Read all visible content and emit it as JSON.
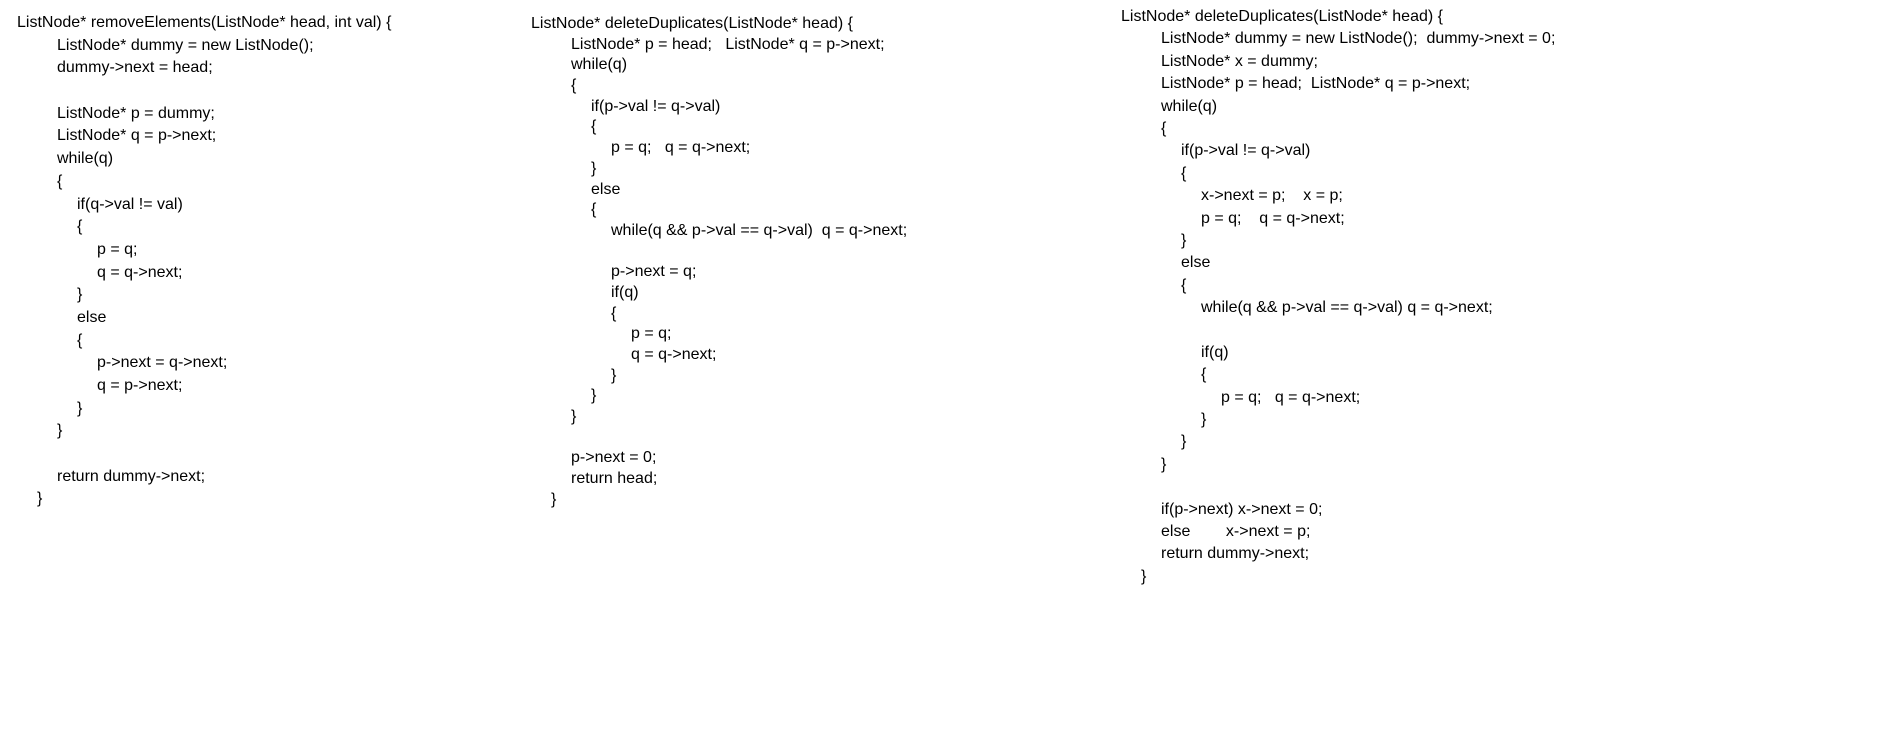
{
  "columns": [
    {
      "name": "remove-elements-code",
      "lines": [
        {
          "indent": 0,
          "text": "ListNode* removeElements(ListNode* head, int val) {"
        },
        {
          "indent": 1,
          "text": "ListNode* dummy = new ListNode();"
        },
        {
          "indent": 1,
          "text": "dummy->next = head;"
        },
        {
          "indent": 1,
          "text": ""
        },
        {
          "indent": 1,
          "text": "ListNode* p = dummy;"
        },
        {
          "indent": 1,
          "text": "ListNode* q = p->next;"
        },
        {
          "indent": 1,
          "text": "while(q)"
        },
        {
          "indent": 1,
          "text": "{"
        },
        {
          "indent": 2,
          "text": "if(q->val != val)"
        },
        {
          "indent": 2,
          "text": "{"
        },
        {
          "indent": 3,
          "text": "p = q;"
        },
        {
          "indent": 3,
          "text": "q = q->next;"
        },
        {
          "indent": 2,
          "text": "}"
        },
        {
          "indent": 2,
          "text": "else"
        },
        {
          "indent": 2,
          "text": "{"
        },
        {
          "indent": 3,
          "text": "p->next = q->next;"
        },
        {
          "indent": 3,
          "text": "q = p->next;"
        },
        {
          "indent": 2,
          "text": "}"
        },
        {
          "indent": 1,
          "text": "}"
        },
        {
          "indent": 1,
          "text": ""
        },
        {
          "indent": 1,
          "text": "return dummy->next;"
        },
        {
          "indent": 0.5,
          "text": "}"
        }
      ]
    },
    {
      "name": "delete-duplicates-code-1",
      "lines": [
        {
          "indent": 0,
          "text": "ListNode* deleteDuplicates(ListNode* head) {"
        },
        {
          "indent": 1,
          "text": "ListNode* p = head;   ListNode* q = p->next;"
        },
        {
          "indent": 1,
          "text": "while(q)"
        },
        {
          "indent": 1,
          "text": "{"
        },
        {
          "indent": 2,
          "text": "if(p->val != q->val)"
        },
        {
          "indent": 2,
          "text": "{"
        },
        {
          "indent": 3,
          "text": "p = q;   q = q->next;"
        },
        {
          "indent": 2,
          "text": "}"
        },
        {
          "indent": 2,
          "text": "else"
        },
        {
          "indent": 2,
          "text": "{"
        },
        {
          "indent": 3,
          "text": "while(q && p->val == q->val)  q = q->next;"
        },
        {
          "indent": 3,
          "text": ""
        },
        {
          "indent": 3,
          "text": "p->next = q;"
        },
        {
          "indent": 3,
          "text": "if(q)"
        },
        {
          "indent": 3,
          "text": "{"
        },
        {
          "indent": 4,
          "text": "p = q;"
        },
        {
          "indent": 4,
          "text": "q = q->next;"
        },
        {
          "indent": 3,
          "text": "}"
        },
        {
          "indent": 2,
          "text": "}"
        },
        {
          "indent": 1,
          "text": "}"
        },
        {
          "indent": 1,
          "text": ""
        },
        {
          "indent": 1,
          "text": "p->next = 0;"
        },
        {
          "indent": 1,
          "text": "return head;"
        },
        {
          "indent": 0.5,
          "text": "}"
        }
      ]
    },
    {
      "name": "delete-duplicates-code-2",
      "lines": [
        {
          "indent": 0,
          "text": "ListNode* deleteDuplicates(ListNode* head) {"
        },
        {
          "indent": 1,
          "text": "ListNode* dummy = new ListNode();  dummy->next = 0;"
        },
        {
          "indent": 1,
          "text": "ListNode* x = dummy;"
        },
        {
          "indent": 1,
          "text": "ListNode* p = head;  ListNode* q = p->next;"
        },
        {
          "indent": 1,
          "text": "while(q)"
        },
        {
          "indent": 1,
          "text": "{"
        },
        {
          "indent": 2,
          "text": "if(p->val != q->val)"
        },
        {
          "indent": 2,
          "text": "{"
        },
        {
          "indent": 3,
          "text": "x->next = p;    x = p;"
        },
        {
          "indent": 3,
          "text": "p = q;    q = q->next;"
        },
        {
          "indent": 2,
          "text": "}"
        },
        {
          "indent": 2,
          "text": "else"
        },
        {
          "indent": 2,
          "text": "{"
        },
        {
          "indent": 3,
          "text": "while(q && p->val == q->val) q = q->next;"
        },
        {
          "indent": 3,
          "text": ""
        },
        {
          "indent": 3,
          "text": "if(q)"
        },
        {
          "indent": 3,
          "text": "{"
        },
        {
          "indent": 4,
          "text": "p = q;   q = q->next;"
        },
        {
          "indent": 3,
          "text": "}"
        },
        {
          "indent": 2,
          "text": "}"
        },
        {
          "indent": 1,
          "text": "}"
        },
        {
          "indent": 1,
          "text": ""
        },
        {
          "indent": 1,
          "text": "if(p->next) x->next = 0;"
        },
        {
          "indent": 1,
          "text": "else        x->next = p;"
        },
        {
          "indent": 1,
          "text": "return dummy->next;"
        },
        {
          "indent": 0.5,
          "text": "}"
        }
      ]
    }
  ]
}
